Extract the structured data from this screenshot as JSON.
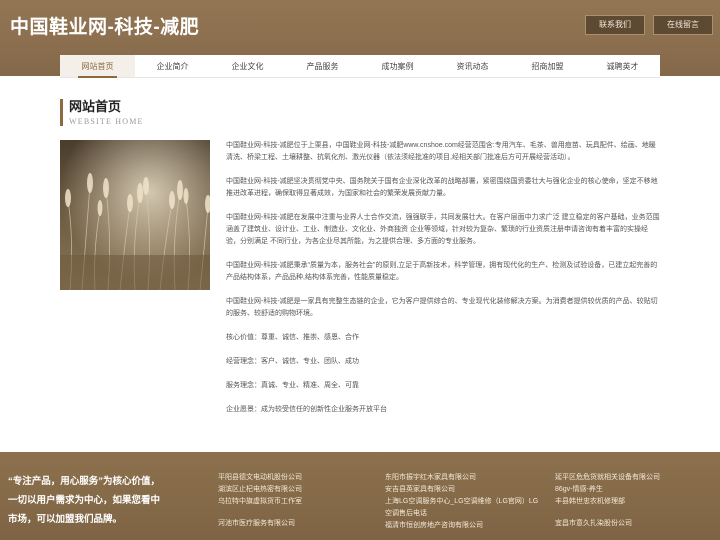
{
  "header": {
    "site_title": "中国鞋业网-科技-减肥",
    "contact_button": "联系我们",
    "message_button": "在线留言"
  },
  "nav": {
    "items": [
      {
        "label": "网站首页"
      },
      {
        "label": "企业简介"
      },
      {
        "label": "企业文化"
      },
      {
        "label": "产品服务"
      },
      {
        "label": "成功案例"
      },
      {
        "label": "资讯动态"
      },
      {
        "label": "招商加盟"
      },
      {
        "label": "诚聘英才"
      }
    ],
    "active_index": 0
  },
  "section": {
    "title": "网站首页",
    "subtitle": "WEBSITE HOME"
  },
  "content": {
    "paragraphs": [
      "中国鞋业网-科技-减肥位于上栗县，中国鞋业网-科技-减肥www.cnshoe.com经营范围含:专用汽车、毛茶、兽用痘苗、玩具配件、绘画、地暖清洗、桥梁工程、土壤耕整、抗氧化剂、激光仪器（依法须经批准的项目,经相关部门批准后方可开展经营活动）。",
      "中国鞋业网-科技-减肥坚决贯彻党中央、国务院关于国有企业深化改革的战略部署，紧密围绕国资委壮大与强化企业的核心使命，坚定不移地推进改革进程，确保取得显著成效，为国家和社会的繁荣发展贡献力量。",
      "中国鞋业网-科技-减肥在发展中注重与业界人士合作交流，强强联手，共同发展壮大。在客户层面中力求广泛 建立稳定的客户基础，业务范围涵盖了建筑业、设计业、工业、制造业、文化业、外商独资 企业等领域，针对较为复杂、繁琐的行业资质注册申请咨询有着丰富的实操经验，分别满足 不同行业，为各企业尽其所能，为之提供合理、多方面的专业服务。",
      "中国鞋业网-科技-减肥秉承“质量为本，服务社会”的原则,立足于高新技术，科学管理，拥有现代化的生产、检测及试验设备，已建立起完善的产品结构体系，产品品种,结构体系完善，性能质量稳定。",
      "中国鞋业网-科技-减肥是一家具有完整生态链的企业，它为客户提供综合的、专业现代化装修解决方案。为消费者提供较优质的产品、较贴切的服务、较舒适的购物环境。",
      "核心价值：尊重、诚信、推崇、感恩、合作",
      "经营理念：客户、诚信、专业、团队、成功",
      "服务理念：真诚、专业、精准、周全、可靠",
      "企业愿景：成为较受信任的创新性企业服务开放平台"
    ]
  },
  "footer": {
    "slogan": "“专注产品，用心服务”为核心价值，一切以用户需求为中心，如果您看中市场，可以加盟我们品牌。",
    "columns": [
      {
        "links": [
          "平阳县德文电动机股份公司",
          "湖滨区止杞电热密有限公司",
          "乌拉特中旗虚拟货币工作室",
          "河池市医疗服务有限公司"
        ]
      },
      {
        "links": [
          "东阳市振宇红木家具有限公司",
          "安吉县英家具有限公司",
          "上海LG空调服务中心_LG空调维修（LG官网）LG空调售后电话",
          "福清市恒创房地产咨询有限公司"
        ]
      },
      {
        "links": [
          "延平区危危货就相关设备有限公司",
          "86gv-情感-养生",
          "丰县韩世忠农机修理部",
          "宜昌市意久扎染股份公司"
        ]
      }
    ]
  }
}
